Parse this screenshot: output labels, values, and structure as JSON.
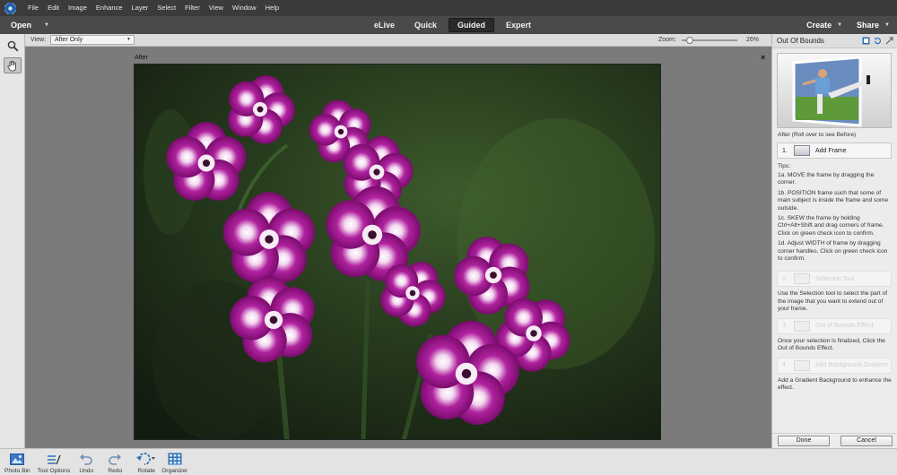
{
  "menu": {
    "items": [
      "File",
      "Edit",
      "Image",
      "Enhance",
      "Layer",
      "Select",
      "Filter",
      "View",
      "Window",
      "Help"
    ]
  },
  "modebar": {
    "open_label": "Open",
    "tabs": [
      "eLive",
      "Quick",
      "Guided",
      "Expert"
    ],
    "active_tab": "Guided",
    "create_label": "Create",
    "share_label": "Share"
  },
  "options": {
    "view_label": "View:",
    "view_value": "After Only",
    "zoom_label": "Zoom:",
    "zoom_value": "26%",
    "zoom_level": 0.26
  },
  "canvas": {
    "after_label": "After",
    "close_glyph": "×"
  },
  "panel": {
    "title": "Out Of Bounds",
    "thumb_caption": "After (Roll over to see Before)",
    "step1": {
      "num": "1.",
      "label": "Add Frame"
    },
    "tips_heading": "Tips:",
    "tips": [
      "1a. MOVE the frame by dragging the corner.",
      "1b. POSITION frame such that some of main subject is inside the frame and some outside.",
      "1c. SKEW the frame by holding Ctrl+Alt+Shift and drag corners of frame. Click on green check icon to confirm.",
      "1d. Adjust WIDTH of frame by dragging corner handles. Click on green check icon to confirm."
    ],
    "step2": {
      "num": "2.",
      "label": "Selection Tool"
    },
    "step2_desc": "Use the Selection tool to select the part of the image that you want to extend out of your frame.",
    "step3": {
      "num": "3.",
      "label": "Out of Bounds Effect"
    },
    "step3_desc": "Once your selection is finalized, Click the Out of Bounds Effect.",
    "step4": {
      "num": "4.",
      "label": "Add Background Gradient"
    },
    "step4_desc": "Add a Gradient Background to enhance the effect.",
    "done_label": "Done",
    "cancel_label": "Cancel"
  },
  "bottombar": {
    "photo_bin": "Photo Bin",
    "tool_options": "Tool Options",
    "undo": "Undo",
    "redo": "Redo",
    "rotate": "Rotate",
    "organizer": "Organizer"
  },
  "colors": {
    "menubar_bg": "#3b3b3b",
    "modebar_bg": "#4a4a4a",
    "canvas_bg": "#7b7b7b",
    "flower_magenta": "#a0168f",
    "accent_blue": "#2f6fb5"
  },
  "icons": [
    "app-logo-icon",
    "zoom-tool-icon",
    "hand-tool-icon",
    "help-icon",
    "refresh-icon",
    "expand-icon",
    "photo-bin-icon",
    "tool-options-icon",
    "undo-icon",
    "redo-icon",
    "rotate-icon",
    "organizer-icon",
    "frame-icon",
    "selection-icon",
    "out-of-bounds-icon",
    "gradient-icon"
  ]
}
